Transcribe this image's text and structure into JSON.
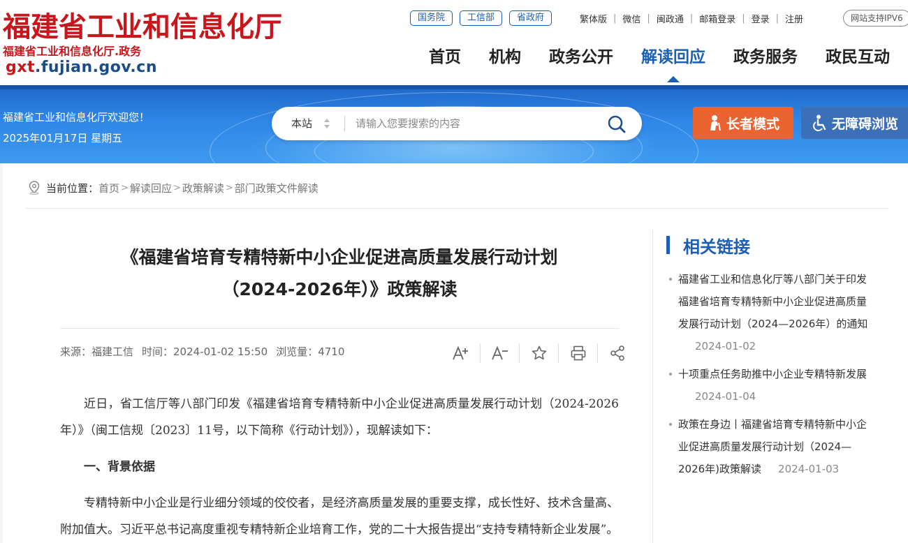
{
  "header": {
    "logo_title": "福建省工业和信息化厅",
    "logo_subtitle": "福建省工业和信息化厅.政务",
    "domain_prefix": "gxt",
    "domain_rest": ".fujian.gov.cn",
    "top_pills": [
      "国务院",
      "工信部",
      "省政府"
    ],
    "utils": [
      "繁体版",
      "微信",
      "闽政通",
      "邮箱登录",
      "登录",
      "注册"
    ],
    "ipv6": "网站支持IPV6",
    "nav": [
      {
        "label": "首页",
        "active": false
      },
      {
        "label": "机构",
        "active": false
      },
      {
        "label": "政务公开",
        "active": false
      },
      {
        "label": "解读回应",
        "active": true
      },
      {
        "label": "政务服务",
        "active": false
      },
      {
        "label": "政民互动",
        "active": false
      }
    ]
  },
  "banner": {
    "welcome": "福建省工业和信息化厅欢迎您！",
    "date": "2025年01月17日 星期五",
    "search_scope": "本站",
    "search_placeholder": "请输入您要搜索的内容",
    "elder_mode": "长者模式",
    "accessible": "无障碍浏览"
  },
  "breadcrumb": {
    "label": "当前位置：",
    "items": [
      "首页",
      "解读回应",
      "政策解读",
      "部门政策文件解读"
    ]
  },
  "article": {
    "title_line1": "《福建省培育专精特新中小企业促进高质量发展行动计划",
    "title_line2": "（2024-2026年）》政策解读",
    "source": "来源：福建工信",
    "time": "时间：2024-01-02 15:50",
    "views": "浏览量：4710",
    "para1": "近日，省工信厅等八部门印发《福建省培育专精特新中小企业促进高质量发展行动计划（2024-2026年）》（闽工信规〔2023〕11号，以下简称《行动计划》），现解读如下：",
    "heading1": "一、背景依据",
    "para2": "专精特新中小企业是行业细分领域的佼佼者，是经济高质量发展的重要支撑，成长性好、技术含量高、附加值大。习近平总书记高度重视专精特新企业培育工作，党的二十大报告提出“支持专精特新企业发展”。"
  },
  "sidebar": {
    "title": "相关链接",
    "links": [
      {
        "text": "福建省工业和信息化厅等八部门关于印发福建省培育专精特新中小企业促进高质量发展行动计划（2024—2026年）的通知",
        "date": "2024-01-02"
      },
      {
        "text": "十项重点任务助推中小企业专精特新发展",
        "date": "2024-01-04"
      },
      {
        "text": "政策在身边丨福建省培育专精特新中小企业促进高质量发展行动计划（2024—2026年)政策解读",
        "date": "2024-01-03"
      }
    ]
  },
  "colors": {
    "brand_red": "#c8161d",
    "brand_blue": "#1a5fb4",
    "elder_orange": "#e96430"
  }
}
